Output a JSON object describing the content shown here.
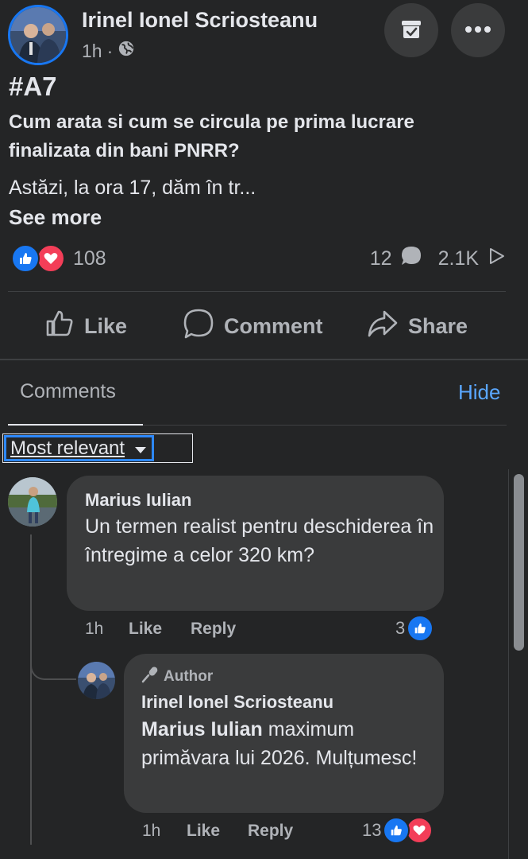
{
  "post": {
    "author": "Irinel Ionel Scriosteanu",
    "time": "1h",
    "separator": "·",
    "privacy_icon": "globe-icon",
    "hashtag": "#A7",
    "headline": "Cum arata si cum se circula pe prima lucrare finalizata din bani PNRR?",
    "text_preview": "Astăzi, la ora 17, dăm în tr...",
    "see_more": "See more",
    "reaction_count": "108",
    "comment_count": "12",
    "share_count": "2.1K"
  },
  "actions": {
    "like": "Like",
    "comment": "Comment",
    "share": "Share"
  },
  "comments_section": {
    "tab": "Comments",
    "hide": "Hide",
    "sort": "Most relevant"
  },
  "comments": [
    {
      "name": "Marius Iulian",
      "text": "Un termen realist pentru deschiderea în întregime a celor 320 km?",
      "time": "1h",
      "like": "Like",
      "reply": "Reply",
      "reactions": "3"
    },
    {
      "badge": "Author",
      "name": "Irinel Ionel Scriosteanu",
      "mention": "Marius Iulian",
      "text": " maximum primăvara lui 2026. Mulțumesc!",
      "time": "1h",
      "like": "Like",
      "reply": "Reply",
      "reactions": "13"
    }
  ],
  "colors": {
    "background": "#242526",
    "bubble": "#3a3b3c",
    "accent_blue": "#1877f2",
    "link_blue": "#5aa7ff",
    "love_red": "#f33e58"
  }
}
